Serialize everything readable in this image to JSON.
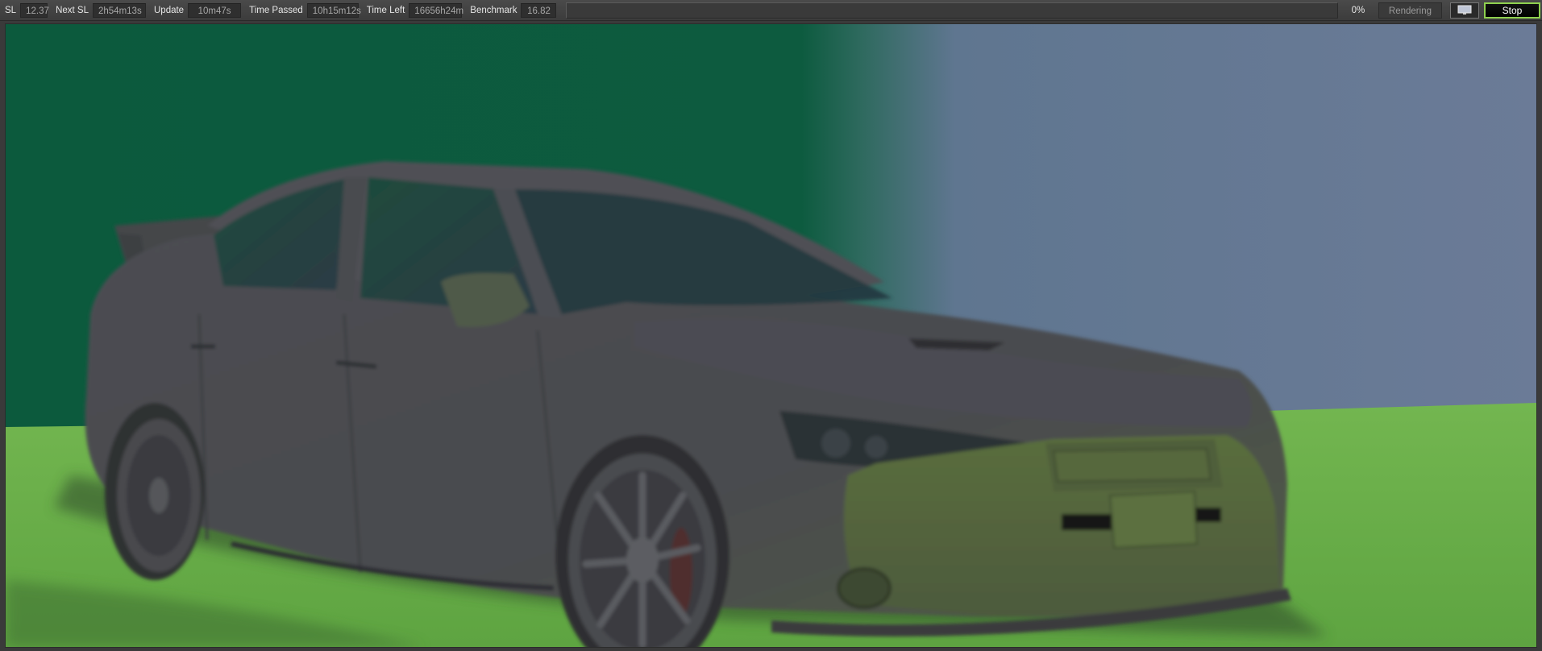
{
  "toolbar": {
    "stats": [
      {
        "label": "SL",
        "value": "12.37"
      },
      {
        "label": "Next SL",
        "value": "2h54m13s"
      },
      {
        "label": "Update",
        "value": "10m47s"
      },
      {
        "label": "Time Passed",
        "value": "10h15m12s"
      },
      {
        "label": "Time Left",
        "value": "16656h24m"
      },
      {
        "label": "Benchmark",
        "value": "16.82"
      }
    ],
    "progress_percent": 0,
    "percent_label": "0%",
    "status": "Rendering",
    "display_icon": "monitor-icon",
    "stop_label": "Stop"
  },
  "colors": {
    "toolbar_bg": "#424242",
    "value_bg": "#2f2f2f",
    "stop_border": "#8fd14f",
    "wall_green": "#0e5a3e",
    "wall_blue": "#6e7e98",
    "floor_green": "#6fb64c",
    "car_body": "#4a4a4e"
  }
}
